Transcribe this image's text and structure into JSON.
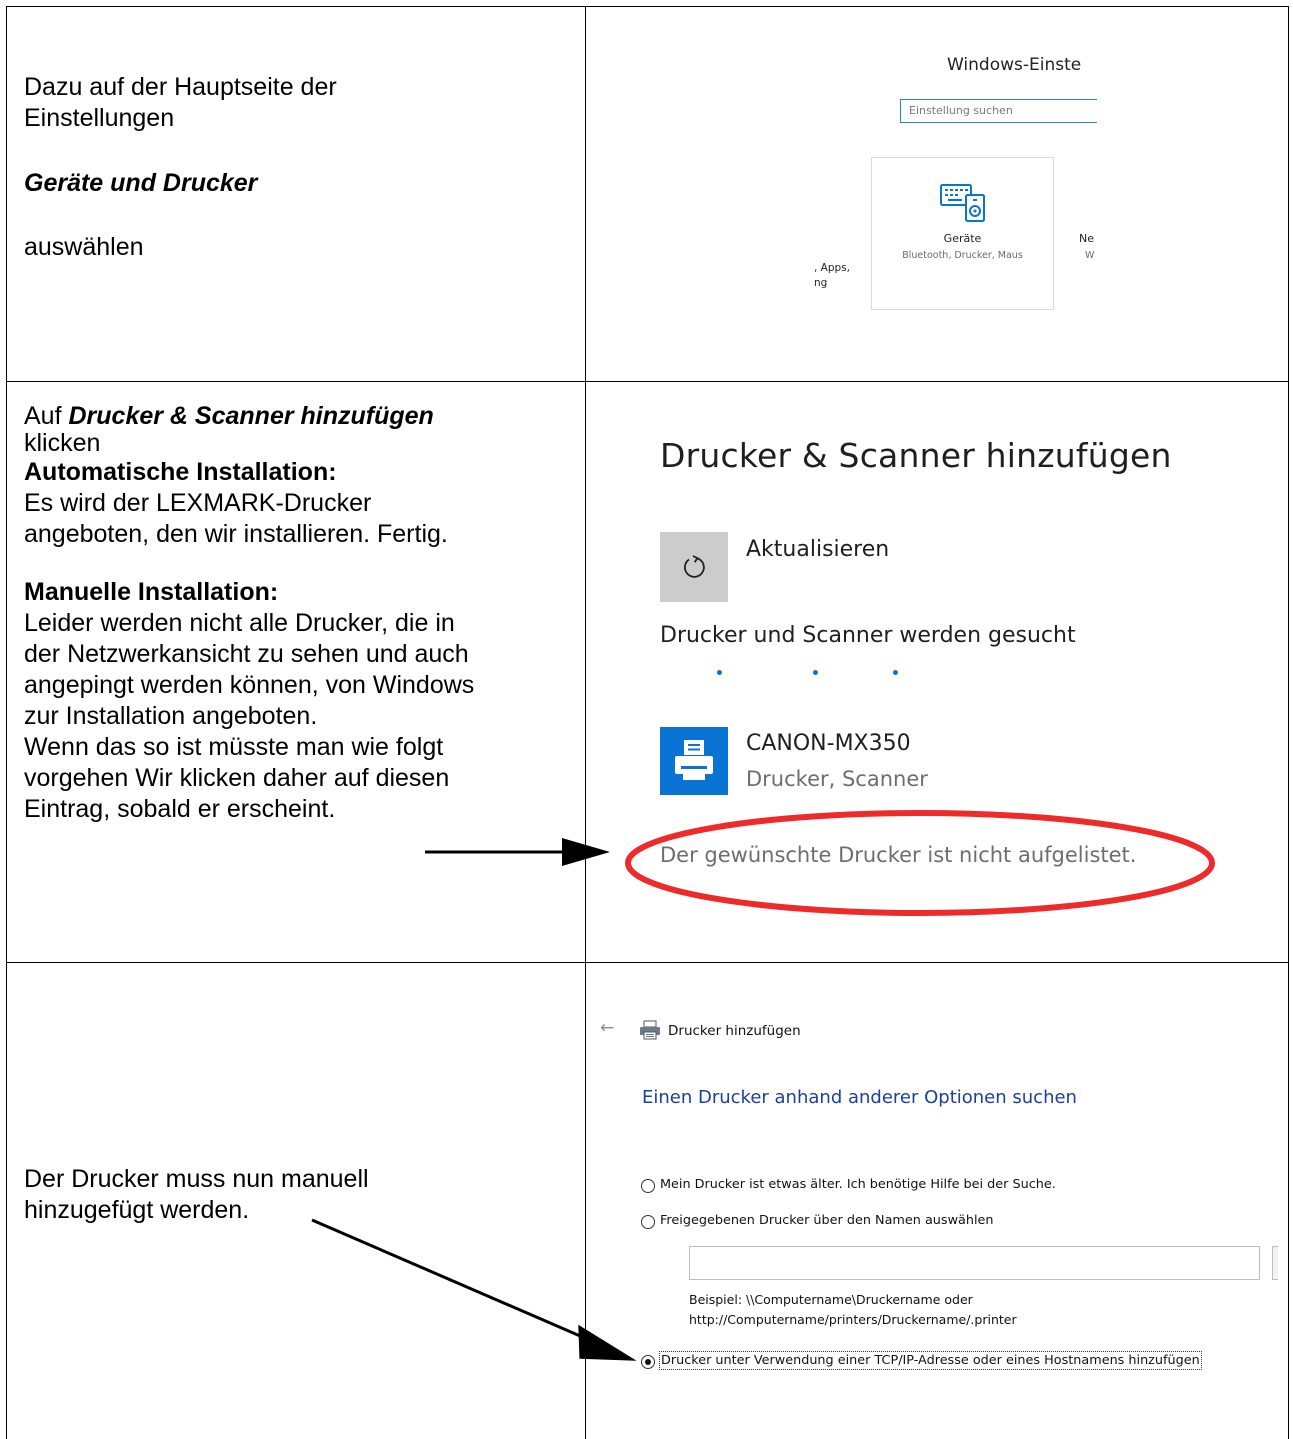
{
  "rows": [
    {
      "instruction": {
        "line1": "Dazu auf der Hauptseite der",
        "line2": "Einstellungen",
        "emphasis": "Geräte und Drucker",
        "line3": "auswählen"
      },
      "screenshot": {
        "window_title": "Windows-Einste",
        "search_placeholder": "Einstellung suchen",
        "tile": {
          "icon": "devices-icon",
          "name": "Geräte",
          "description": "Bluetooth, Drucker, Maus"
        },
        "left_fragment_1": ", Apps,",
        "left_fragment_2": "ng",
        "right_fragment_1": "Ne",
        "right_fragment_2": "W"
      }
    },
    {
      "instruction": {
        "prefix": "Auf",
        "emphasis": "Drucker & Scanner hinzufügen",
        "line2": "klicken",
        "auto_heading": "Automatische Installation:",
        "auto_lines": [
          "Es wird der LEXMARK-Drucker",
          "angeboten, den wir installieren. Fertig."
        ],
        "manual_heading": "Manuelle Installation:",
        "manual_lines": [
          "Leider werden nicht alle Drucker, die in",
          "der Netzwerkansicht zu sehen und auch",
          "angepingt werden können, von Windows",
          "zur Installation angeboten.",
          "Wenn das so ist müsste man wie folgt",
          "vorgehen Wir klicken daher auf diesen",
          "Eintrag, sobald er erscheint."
        ]
      },
      "screenshot": {
        "heading": "Drucker & Scanner hinzufügen",
        "refresh_icon": "refresh-icon",
        "refresh_label": "Aktualisieren",
        "status": "Drucker und Scanner werden gesucht",
        "printer_icon": "printer-icon",
        "printer_name": "CANON-MX350",
        "printer_type": "Drucker, Scanner",
        "not_listed_link": "Der gewünschte Drucker ist nicht aufgelistet.",
        "highlight_color": "#ee2a2a",
        "accent_color": "#0a74d4"
      }
    },
    {
      "instruction": {
        "lines": [
          "Der Drucker muss nun manuell",
          "hinzugefügt werden."
        ]
      },
      "screenshot": {
        "back_icon": "back-arrow-icon",
        "title_icon": "printer-icon",
        "title": "Drucker hinzufügen",
        "subtitle": "Einen Drucker anhand anderer Optionen suchen",
        "options": [
          {
            "label": "Mein Drucker ist etwas älter. Ich benötige Hilfe bei der Suche.",
            "selected": false
          },
          {
            "label": "Freigegebenen Drucker über den Namen auswählen",
            "selected": false
          },
          {
            "label": "Drucker unter Verwendung einer TCP/IP-Adresse oder eines Hostnamens hinzufügen",
            "selected": true
          }
        ],
        "name_input_value": "",
        "example_lines": [
          "Beispiel: \\\\Computername\\Druckername oder",
          "http://Computername/printers/Druckername/.printer"
        ],
        "subtitle_color": "#1a3f9c"
      }
    }
  ]
}
